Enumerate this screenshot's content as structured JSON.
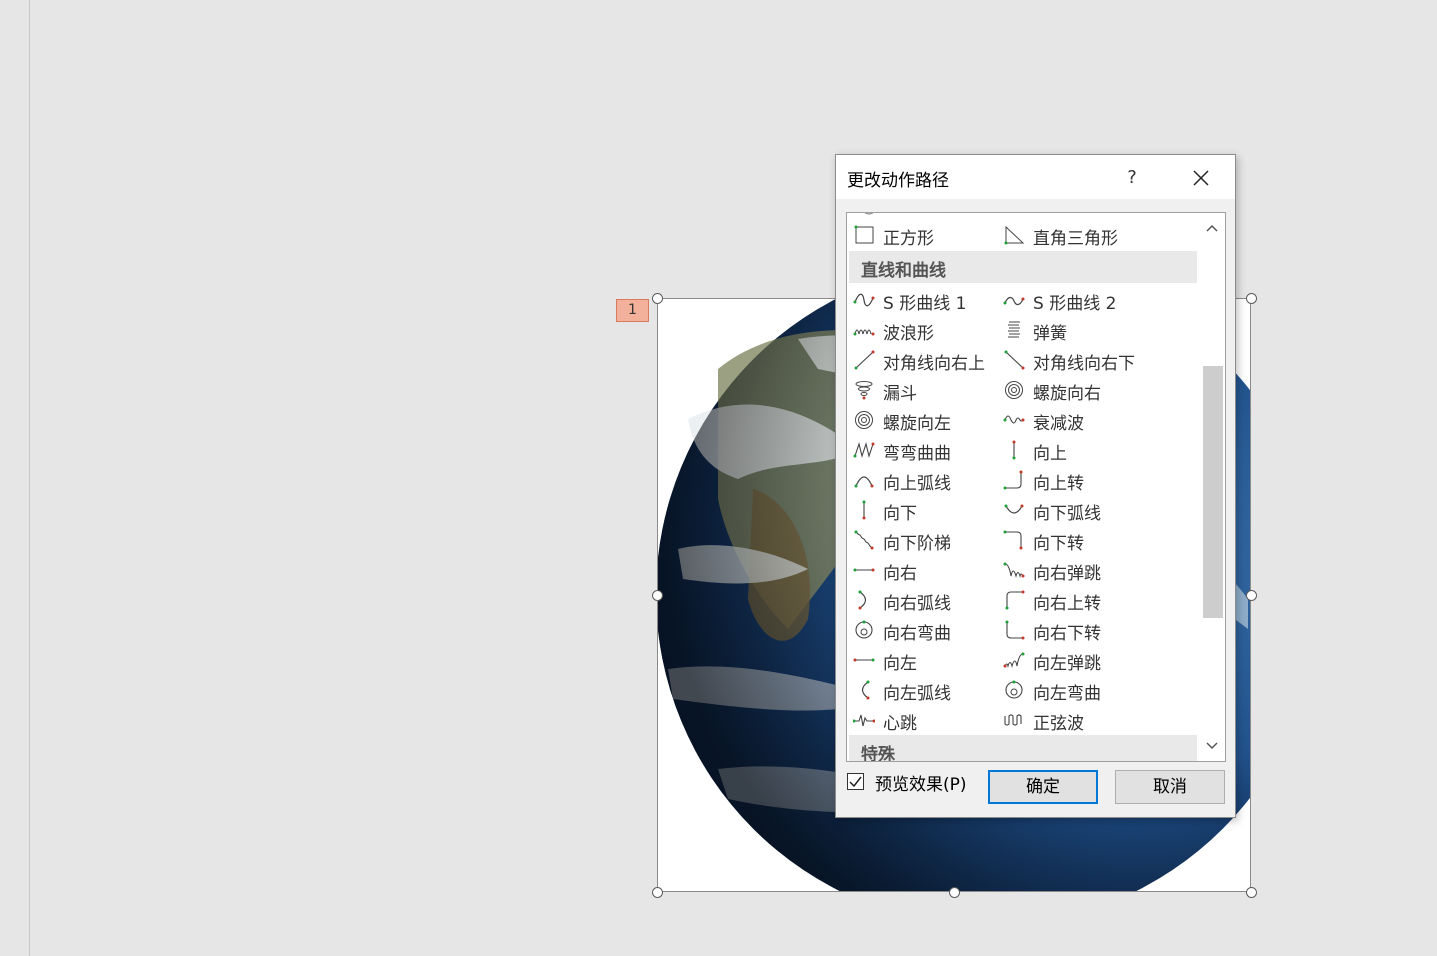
{
  "slide": {
    "animation_tag": "1"
  },
  "dialog": {
    "title": "更改动作路径",
    "help_label": "?",
    "preview": {
      "label": "预览效果(P)",
      "checked": true
    },
    "ok_label": "确定",
    "cancel_label": "取消"
  },
  "list": {
    "top_items": [
      "正方形",
      "直角三角形"
    ],
    "group_lines": "直线和曲线",
    "items": [
      "S 形曲线 1",
      "S 形曲线 2",
      "波浪形",
      "弹簧",
      "对角线向右上",
      "对角线向右下",
      "漏斗",
      "螺旋向右",
      "螺旋向左",
      "衰减波",
      "弯弯曲曲",
      "向上",
      "向上弧线",
      "向上转",
      "向下",
      "向下弧线",
      "向下阶梯",
      "向下转",
      "向右",
      "向右弹跳",
      "向右弧线",
      "向右上转",
      "向右弯曲",
      "向右下转",
      "向左",
      "向左弹跳",
      "向左弧线",
      "向左弯曲",
      "心跳",
      "正弦波"
    ],
    "group_special": "特殊"
  },
  "colors": {
    "accent": "#0078d7",
    "path_start": "#1f9e3a",
    "path_end": "#c0392b",
    "tag": "#f3b09b"
  }
}
